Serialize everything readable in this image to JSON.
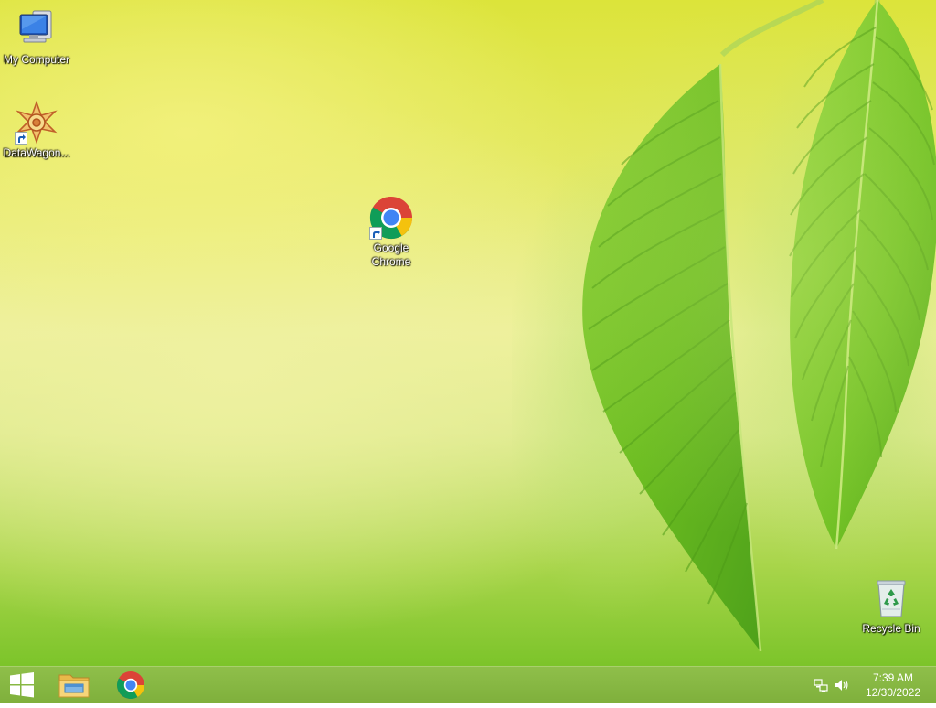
{
  "desktop": {
    "icons": [
      {
        "label": "My Computer",
        "icon": "computer-icon"
      },
      {
        "label": "DataWagon...",
        "icon": "datawagon-icon"
      },
      {
        "label": "Google Chrome",
        "icon": "chrome-icon"
      },
      {
        "label": "Recycle Bin",
        "icon": "recycle-bin-icon"
      }
    ]
  },
  "taskbar": {
    "start": {
      "icon": "windows-logo-icon"
    },
    "pinned": [
      {
        "icon": "file-explorer-icon"
      },
      {
        "icon": "chrome-icon"
      }
    ],
    "tray": {
      "network_icon": "network-icon",
      "volume_icon": "volume-icon",
      "time": "7:39 AM",
      "date": "12/30/2022"
    }
  },
  "colors": {
    "taskbar": "#82b340",
    "wallpaper_top": "#dce43a",
    "wallpaper_bottom": "#7cc42a",
    "chrome_red": "#db4437",
    "chrome_yellow": "#f4c20d",
    "chrome_green": "#0f9d58",
    "chrome_blue": "#4285f4"
  }
}
